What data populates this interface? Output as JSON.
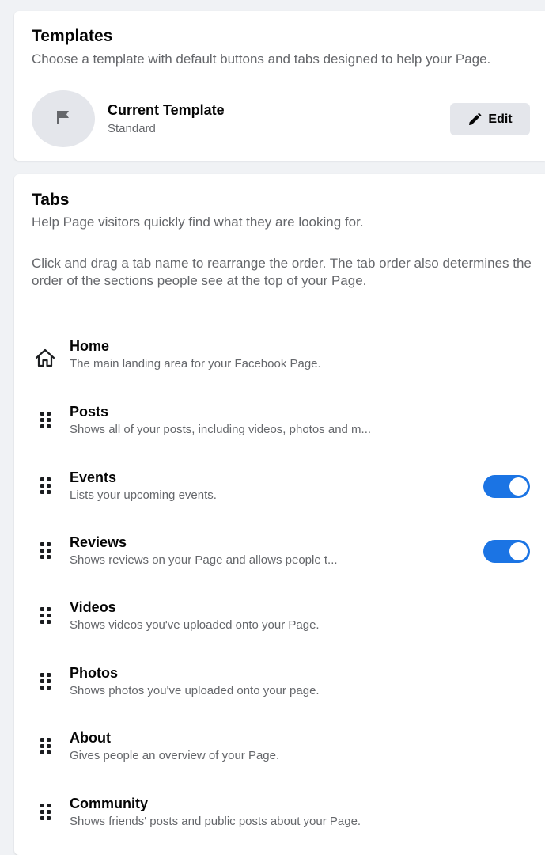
{
  "templates": {
    "title": "Templates",
    "description": "Choose a template with default buttons and tabs designed to help your Page.",
    "current_label": "Current Template",
    "current_value": "Standard",
    "edit_label": "Edit",
    "avatar_icon": "flag-icon",
    "edit_icon": "pencil-icon"
  },
  "tabs_section": {
    "title": "Tabs",
    "description": "Help Page visitors quickly find what they are looking for.",
    "instructions": "Click and drag a tab name to rearrange the order. The tab order also determines the order of the sections people see at the top of your Page."
  },
  "tabs": [
    {
      "title": "Home",
      "description": "The main landing area for your Facebook Page.",
      "icon": "home-icon"
    },
    {
      "title": "Posts",
      "description": "Shows all of your posts, including videos, photos and m...",
      "icon": "drag-handle-icon"
    },
    {
      "title": "Events",
      "description": "Lists your upcoming events.",
      "icon": "drag-handle-icon",
      "toggle_on": true
    },
    {
      "title": "Reviews",
      "description": "Shows reviews on your Page and allows people t...",
      "icon": "drag-handle-icon",
      "toggle_on": true
    },
    {
      "title": "Videos",
      "description": "Shows videos you've uploaded onto your Page.",
      "icon": "drag-handle-icon"
    },
    {
      "title": "Photos",
      "description": "Shows photos you've uploaded onto your page.",
      "icon": "drag-handle-icon"
    },
    {
      "title": "About",
      "description": "Gives people an overview of your Page.",
      "icon": "drag-handle-icon"
    },
    {
      "title": "Community",
      "description": "Shows friends' posts and public posts about your Page.",
      "icon": "drag-handle-icon"
    }
  ],
  "colors": {
    "accent": "#1b74e4",
    "background": "#f0f2f5",
    "secondary_text": "#65676b"
  }
}
